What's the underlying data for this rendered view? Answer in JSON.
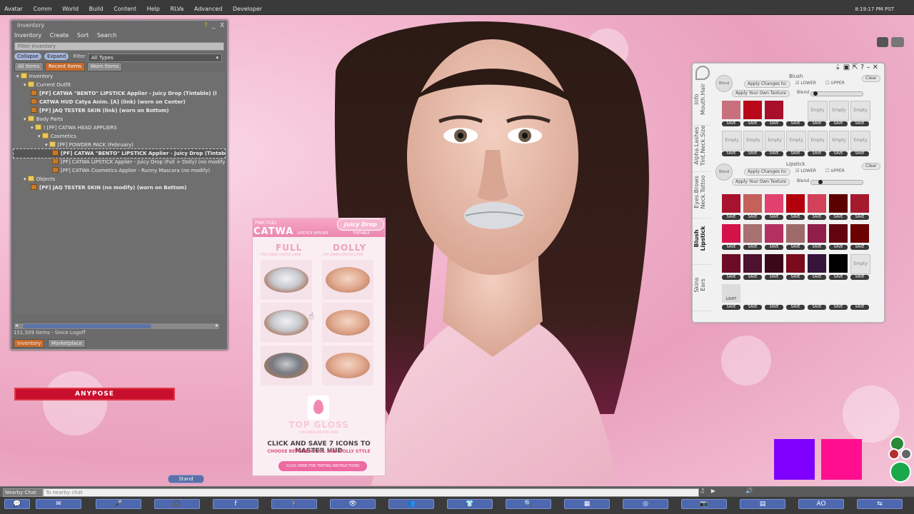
{
  "topbar": {
    "menu": [
      "Avatar",
      "Comm",
      "World",
      "Build",
      "Content",
      "Help",
      "RLVa",
      "Advanced",
      "Developer"
    ],
    "clock": "8:19:17 PM PST"
  },
  "inventory": {
    "title": "Inventory",
    "help": "?",
    "minimize": "_",
    "close": "X",
    "menu": [
      "Inventory",
      "Create",
      "Sort",
      "Search"
    ],
    "filter_placeholder": "Filter Inventory",
    "collapse": "Collapse",
    "expand": "Expand",
    "filter_label": "Filter",
    "filter_value": "All Types",
    "tabs": [
      "All Items",
      "Recent Items",
      "Worn Items"
    ],
    "active_tab": "Recent Items",
    "tree": [
      {
        "text": "Inventory",
        "bold": false,
        "indent": 0,
        "icon": "folder"
      },
      {
        "text": "Current Outfit",
        "bold": false,
        "indent": 1,
        "icon": "folder"
      },
      {
        "text": "[PF] CATWA \"BENTO\" LIPSTICK Applier - Juicy Drop (Tintable) (l",
        "bold": true,
        "indent": 2,
        "icon": "object"
      },
      {
        "text": "CATWA HUD Catya Anim. [A] (link) (worn on Center)",
        "bold": true,
        "indent": 2,
        "icon": "object"
      },
      {
        "text": "[PF] JAQ TESTER SKIN (link) (worn on Bottom)",
        "bold": true,
        "indent": 2,
        "icon": "object"
      },
      {
        "text": "Body Parts",
        "bold": false,
        "indent": 1,
        "icon": "folder"
      },
      {
        "text": "! [PF] CATWA HEAD APPLIERS",
        "bold": false,
        "indent": 2,
        "icon": "folder"
      },
      {
        "text": "Cosmetics",
        "bold": false,
        "indent": 3,
        "icon": "folder"
      },
      {
        "text": "[PF] POWDER PACK (February)",
        "bold": false,
        "indent": 4,
        "icon": "folder"
      },
      {
        "text": "[PF] CATWA \"BENTO\" LIPSTICK Applier - Juicy Drop (Tintabl",
        "bold": true,
        "indent": 5,
        "icon": "object",
        "selected": true
      },
      {
        "text": "[PF] CATWA LIPSTICK Applier - Juicy Drop (Full + Dolly) (no modify)",
        "bold": false,
        "indent": 5,
        "icon": "object"
      },
      {
        "text": "[PF] CATWA Cosmetics Applier - Runny Mascara (no modify)",
        "bold": false,
        "indent": 5,
        "icon": "object"
      },
      {
        "text": "Objects",
        "bold": false,
        "indent": 1,
        "icon": "folder"
      },
      {
        "text": "[PF] JAQ TESTER SKIN (no modify) (worn on Bottom)",
        "bold": true,
        "indent": 2,
        "icon": "object"
      }
    ],
    "status": "151,509 Items  - Since Logoff",
    "bottom_tabs": [
      "Inventory",
      "Marketplace"
    ]
  },
  "anypose": "ANYPOSE",
  "catwa": {
    "pink_fuel": "PINK FUEL",
    "brand": "CATWA",
    "sub": "LIPSTICK APPLIER",
    "juicy_drop": "Juicy Drop",
    "tintable": "TINTABLE",
    "full": "FULL",
    "full_sub": "FOR LOWER LIPSTICK LAYER",
    "dolly": "DOLLY",
    "dolly_sub": "FOR LOWER LIPSTICK LAYER",
    "top_gloss": "TOP GLOSS",
    "top_gloss_sub": "FOR UPPER LIPSTICK LAYER",
    "click_save": "CLICK AND SAVE 7 ICONS TO MASTER HUD",
    "choose": "CHOOSE BETWEEN FULL AND DOLLY STYLE",
    "cta": "CLICK HERE FOR TINTING INSTRUCTIONS"
  },
  "hud": {
    "vtabs": [
      "Info\nMouth.Hair",
      "Alpha.Lashes\nTint.Neck.Size",
      "Eyes.Brows\nNeck.Tattoo",
      "Blush\nLipstick",
      "Skins\nEars"
    ],
    "active_vtab": 3,
    "blush_title": "Blush",
    "lipstick_title": "Lipstick",
    "apply_changes": "Apply Changes to:",
    "lower": "LOWER",
    "upper": "UPPER",
    "apply_own": "Apply Your Own Texture",
    "blend": "Blend",
    "clear": "Clear",
    "empty": "Empty",
    "save": "SAVE",
    "light_label": "LIGHT",
    "blush_colors": [
      "#c9707e",
      "#b8081a",
      "#a80f2a"
    ],
    "lipstick_rows": [
      [
        "#a8122e",
        "#c4615b",
        "#e0426d",
        "#b3000c",
        "#d2405a",
        "#5d0000",
        "#a61a2e"
      ],
      [
        "#d3124a",
        "#a87070",
        "#b33060",
        "#9e6a6a",
        "#8f1e48",
        "#620410",
        "#6b0000"
      ],
      [
        "#6e0b25",
        "#4e1230",
        "#3a0818",
        "#7a0a1c",
        "#36143c",
        "#000000"
      ]
    ]
  },
  "stand": "Stand",
  "chat": {
    "nearby": "Nearby Chat",
    "placeholder": "To nearby chat"
  },
  "toolbar": {
    "ao": "AO"
  },
  "colors": {
    "purple_swatch": "#7f00ff",
    "pink_swatch": "#ff0f8f"
  }
}
